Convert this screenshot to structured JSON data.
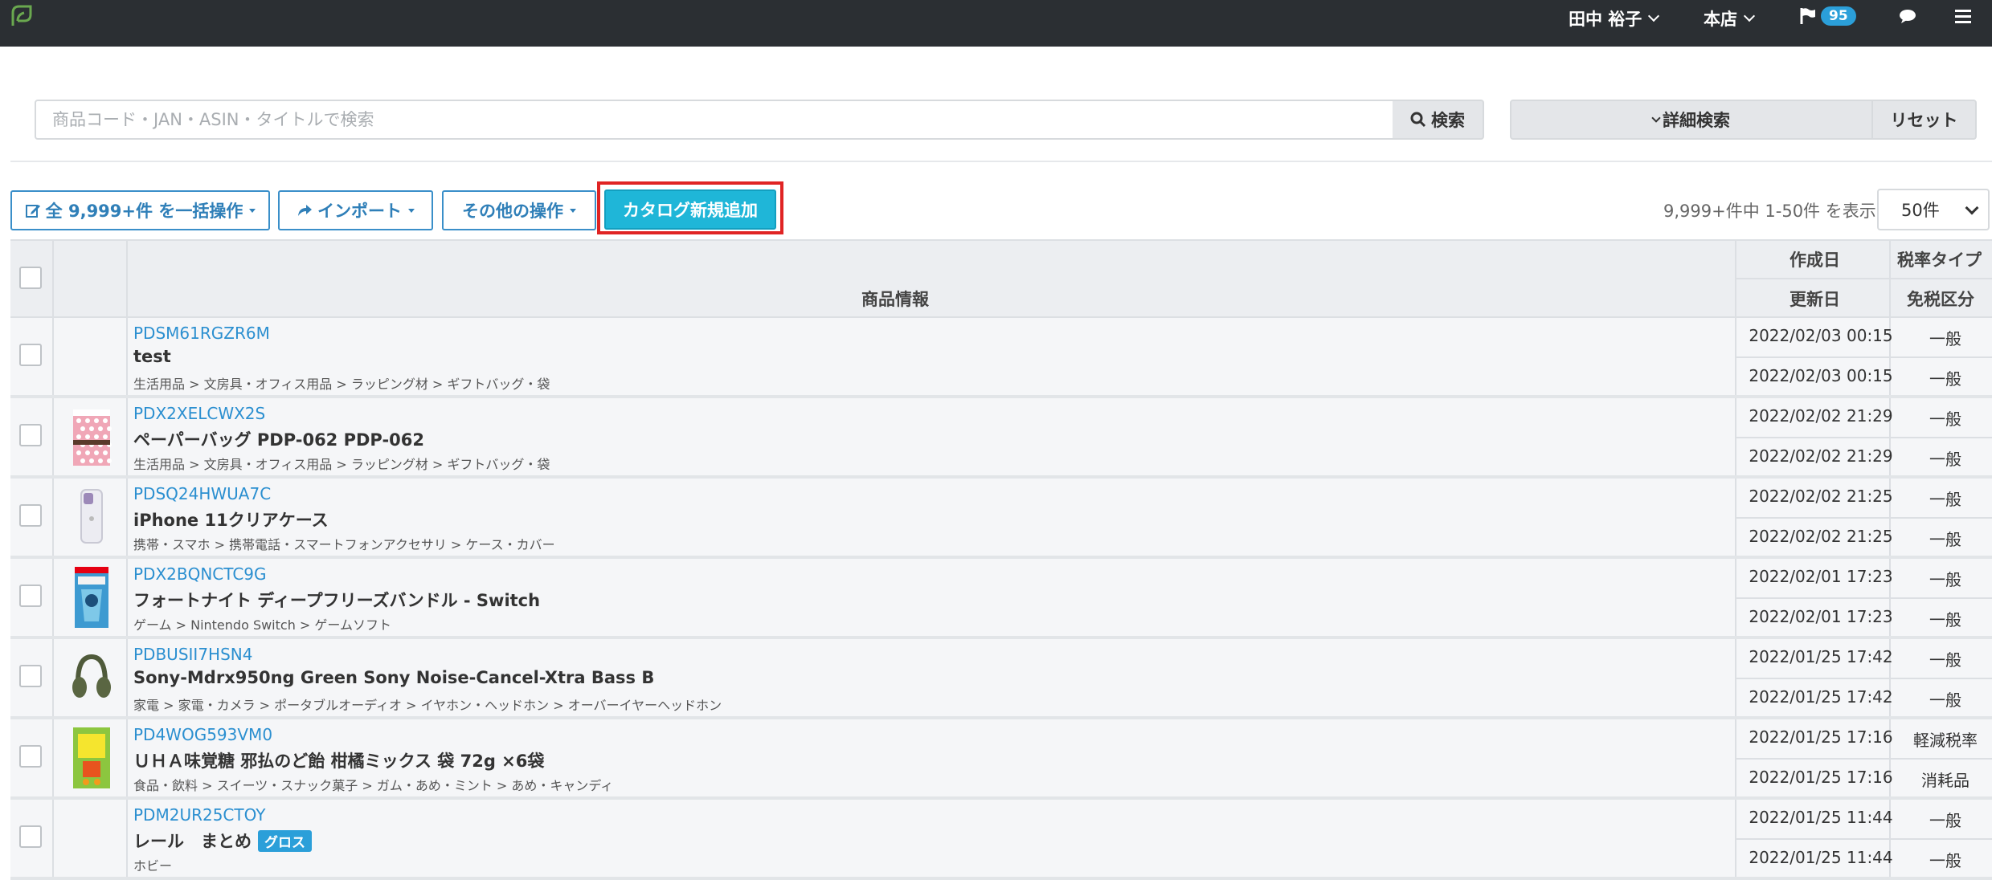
{
  "header": {
    "user_name": "田中 裕子",
    "store_name": "本店",
    "notification_count": "95"
  },
  "search": {
    "placeholder": "商品コード・JAN・ASIN・タイトルで検索",
    "search_label": "検索",
    "detail_search_label": "詳細検索",
    "reset_label": "リセット"
  },
  "toolbar": {
    "bulk_label": "全 9,999+件 を一括操作",
    "import_label": "インポート",
    "other_label": "その他の操作",
    "catalog_add_label": "カタログ新規追加",
    "range_text": "9,999+件中 1-50件 を表示",
    "per_page": "50件"
  },
  "table": {
    "columns": {
      "product_info": "商品情報",
      "created": "作成日",
      "updated": "更新日",
      "tax_rate_type": "税率タイプ",
      "tax_category": "免税区分"
    },
    "rows": [
      {
        "code": "PDSM61RGZR6M",
        "title": "test",
        "category": "生活用品 > 文房具・オフィス用品 > ラッピング材 > ギフトバッグ・袋",
        "created": "2022/02/03 00:15",
        "updated": "2022/02/03 00:15",
        "tax_rate": "一般",
        "tax_exempt": "一般",
        "thumb": "none"
      },
      {
        "code": "PDX2XELCWX2S",
        "title": "ペーパーバッグ PDP-062 PDP-062",
        "category": "生活用品 > 文房具・オフィス用品 > ラッピング材 > ギフトバッグ・袋",
        "created": "2022/02/02 21:29",
        "updated": "2022/02/02 21:29",
        "tax_rate": "一般",
        "tax_exempt": "一般",
        "thumb": "paper-bag"
      },
      {
        "code": "PDSQ24HWUA7C",
        "title": "iPhone 11クリアケース",
        "category": "携帯・スマホ > 携帯電話・スマートフォンアクセサリ > ケース・カバー",
        "created": "2022/02/02 21:25",
        "updated": "2022/02/02 21:25",
        "tax_rate": "一般",
        "tax_exempt": "一般",
        "thumb": "phone-case"
      },
      {
        "code": "PDX2BQNCTC9G",
        "title": "フォートナイト ディープフリーズバンドル - Switch",
        "category": "ゲーム > Nintendo Switch > ゲームソフト",
        "created": "2022/02/01 17:23",
        "updated": "2022/02/01 17:23",
        "tax_rate": "一般",
        "tax_exempt": "一般",
        "thumb": "game-box"
      },
      {
        "code": "PDBUSII7HSN4",
        "title": "Sony-Mdrx950ng Green Sony Noise-Cancel-Xtra Bass B",
        "category": "家電 > 家電・カメラ > ポータブルオーディオ > イヤホン・ヘッドホン > オーバーイヤーヘッドホン",
        "created": "2022/01/25 17:42",
        "updated": "2022/01/25 17:42",
        "tax_rate": "一般",
        "tax_exempt": "一般",
        "thumb": "headphones"
      },
      {
        "code": "PD4WOG593VM0",
        "title": "ＵＨＡ味覚糖 邪払のど飴 柑橘ミックス 袋 72g ×6袋",
        "category": "食品・飲料 > スイーツ・スナック菓子 > ガム・あめ・ミント > あめ・キャンディ",
        "created": "2022/01/25 17:16",
        "updated": "2022/01/25 17:16",
        "tax_rate": "軽減税率",
        "tax_exempt": "消耗品",
        "thumb": "candy"
      },
      {
        "code": "PDM2UR25CTOY",
        "title": "レール　まとめ",
        "badge": "グロス",
        "category": "ホビー",
        "created": "2022/01/25 11:44",
        "updated": "2022/01/25 11:44",
        "tax_rate": "一般",
        "tax_exempt": "一般",
        "thumb": "none"
      }
    ]
  }
}
